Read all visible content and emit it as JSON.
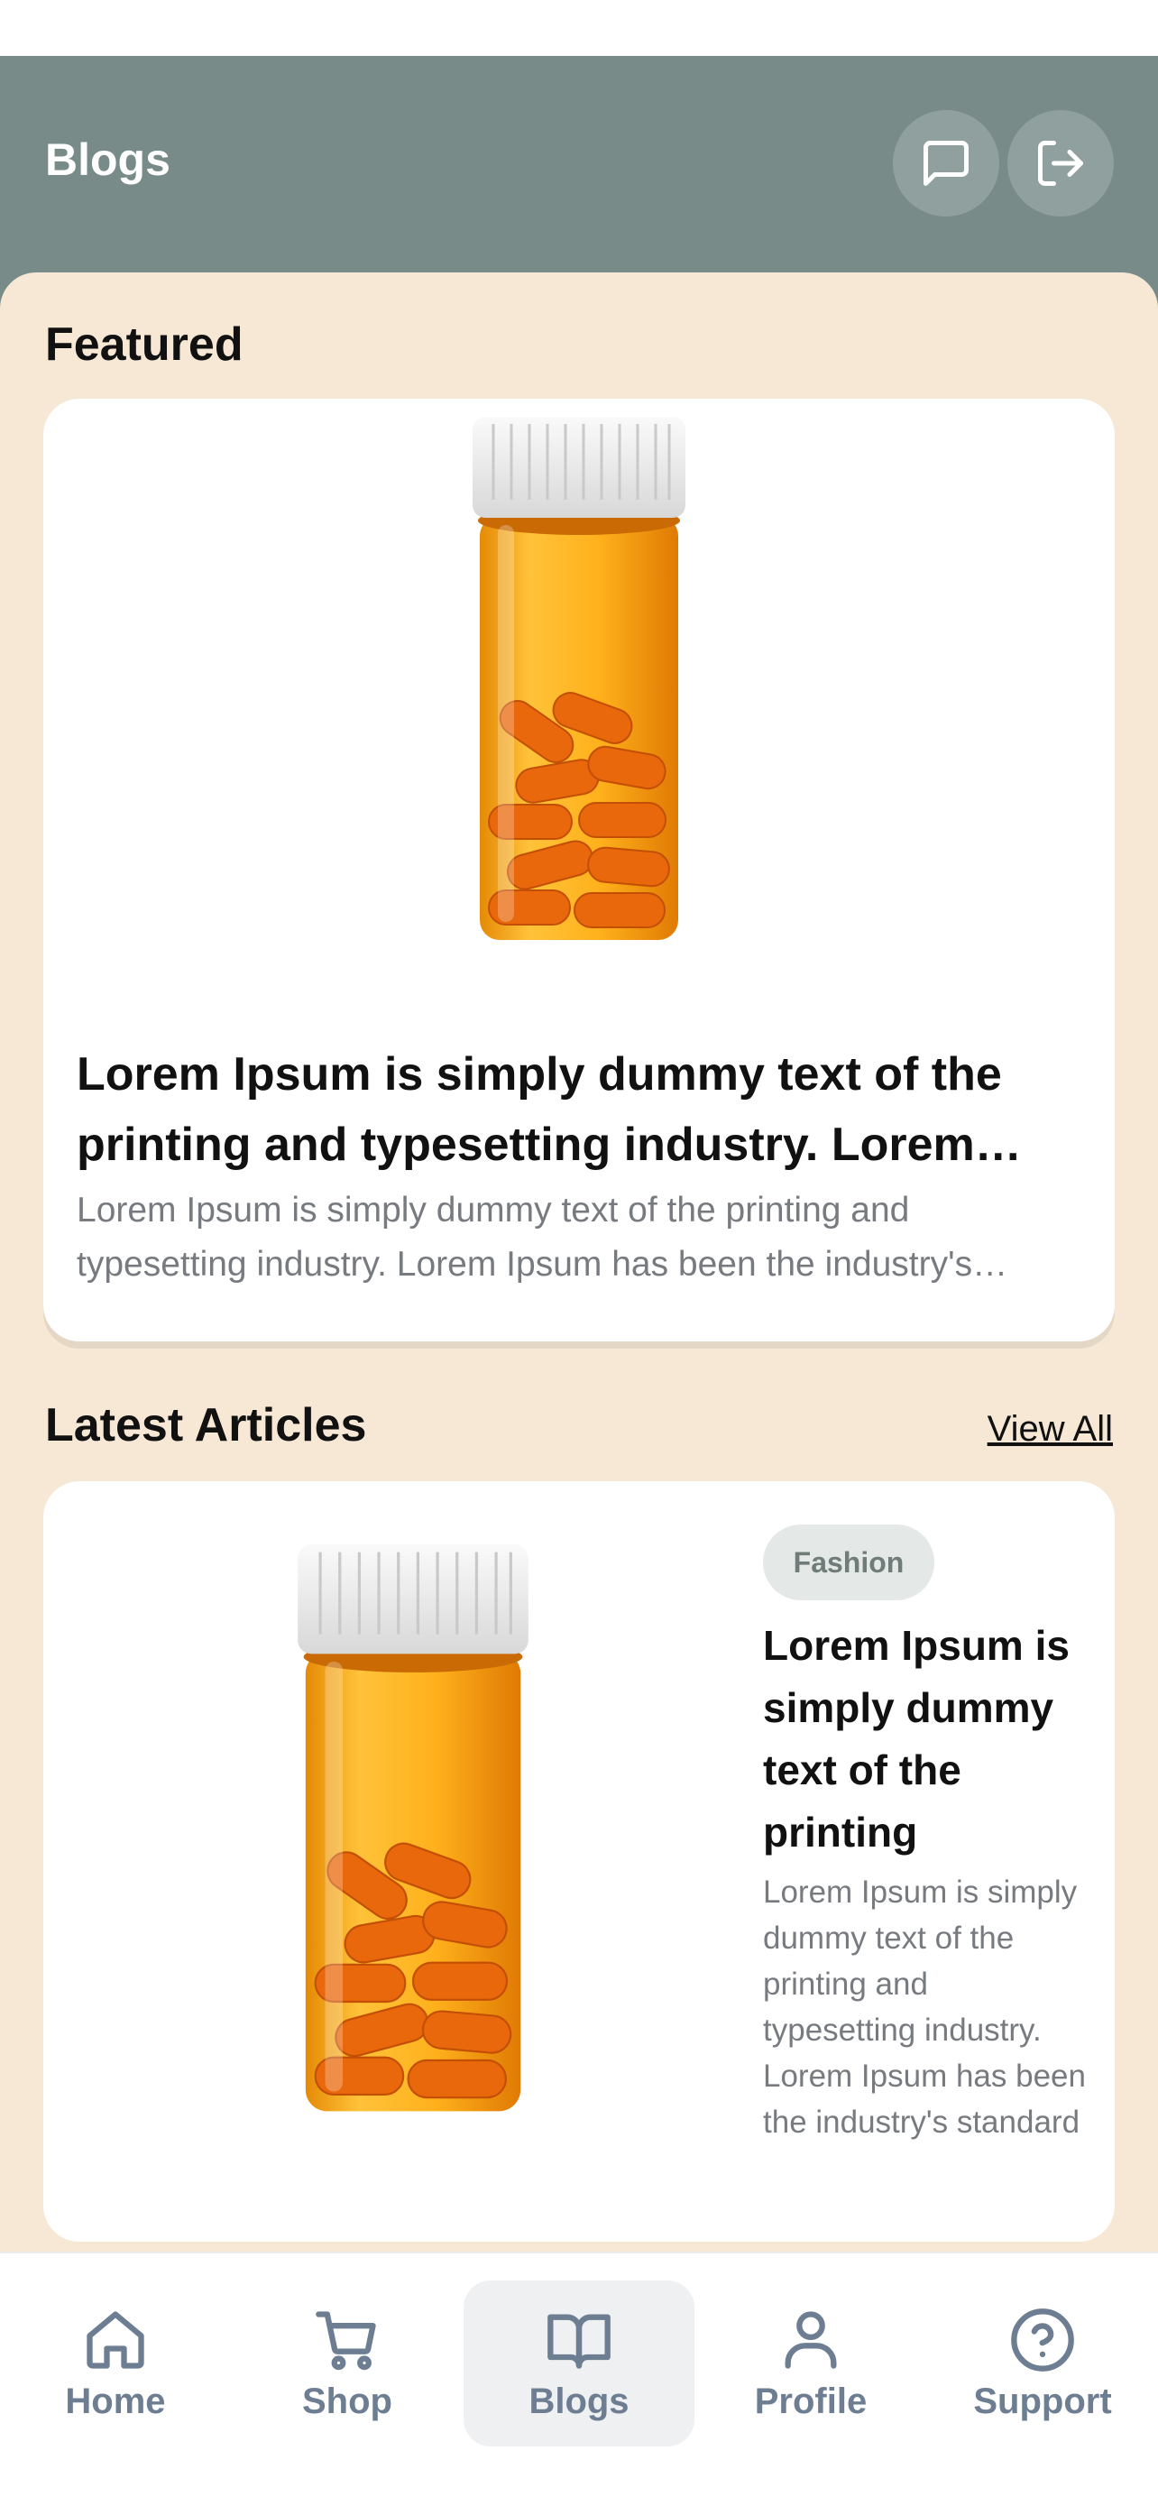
{
  "header": {
    "title": "Blogs",
    "chat_icon": "message-square-icon",
    "logout_icon": "log-out-icon"
  },
  "featured": {
    "section_title": "Featured",
    "image": "pill-bottle-image",
    "headline": "Lorem Ipsum is simply dummy text of the printing and typesetting industry. Lorem Ipsum has been the industry's standard",
    "excerpt": "Lorem Ipsum is simply dummy text of the printing and typesetting industry. Lorem Ipsum has been the industry's standard dummy text"
  },
  "latest": {
    "section_title": "Latest Articles",
    "view_all_label": "View All",
    "articles": [
      {
        "image": "pill-bottle-image",
        "tag": "Fashion",
        "title": "Lorem Ipsum is simply dummy text of the printing",
        "excerpt": "Lorem Ipsum is simply dummy text of the printing and typesetting industry. Lorem Ipsum has been the industry's standard"
      }
    ]
  },
  "nav": {
    "items": [
      {
        "label": "Home",
        "icon": "home-icon",
        "active": false
      },
      {
        "label": "Shop",
        "icon": "cart-icon",
        "active": false
      },
      {
        "label": "Blogs",
        "icon": "book-icon",
        "active": true
      },
      {
        "label": "Profile",
        "icon": "user-icon",
        "active": false
      },
      {
        "label": "Support",
        "icon": "help-circle-icon",
        "active": false
      }
    ]
  },
  "colors": {
    "header_bg": "#788b89",
    "content_bg": "#f6e8d4",
    "nav_icon": "#6e7e92",
    "tag_bg": "#e4e8e6"
  }
}
